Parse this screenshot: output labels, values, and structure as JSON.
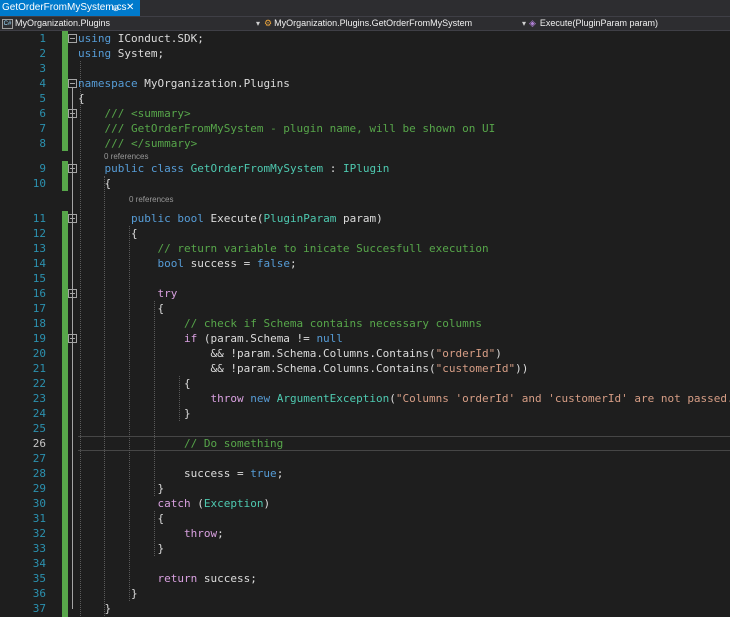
{
  "tab": {
    "filename": "GetOrderFromMySystem.cs",
    "pin": "⊕",
    "close": "✕"
  },
  "navbar": {
    "project": "MyOrganization.Plugins",
    "type_path": "MyOrganization.Plugins.GetOrderFromMySystem",
    "member": "Execute(PluginParam param)"
  },
  "colors": {
    "accent": "#007acc",
    "keyword": "#569cd6",
    "comment": "#57a64a",
    "type": "#4ec9b0",
    "string": "#d69d85",
    "control": "#d8a0df",
    "line_number": "#2b91af"
  },
  "current_line": 26,
  "codelens": {
    "class_refs": "0 references",
    "method_refs": "0 references"
  },
  "lines": [
    [
      [
        "kw",
        "using"
      ],
      [
        "p",
        " IConduct.SDK;"
      ]
    ],
    [
      [
        "kw",
        "using"
      ],
      [
        "p",
        " System;"
      ]
    ],
    [],
    [
      [
        "kw",
        "namespace"
      ],
      [
        "p",
        " MyOrganization.Plugins"
      ]
    ],
    [
      [
        "p",
        "{"
      ]
    ],
    [
      [
        "p",
        "    "
      ],
      [
        "cm",
        "/// <summary>"
      ]
    ],
    [
      [
        "p",
        "    "
      ],
      [
        "cm",
        "/// GetOrderFromMySystem - plugin name, will be shown on UI"
      ]
    ],
    [
      [
        "p",
        "    "
      ],
      [
        "cm",
        "/// </summary>"
      ]
    ],
    [
      [
        "p",
        "    "
      ],
      [
        "kw",
        "public"
      ],
      [
        "p",
        " "
      ],
      [
        "kw",
        "class"
      ],
      [
        "p",
        " "
      ],
      [
        "cl",
        "GetOrderFromMySystem"
      ],
      [
        "p",
        " : "
      ],
      [
        "cl",
        "IPlugin"
      ]
    ],
    [
      [
        "p",
        "    {"
      ]
    ],
    [
      [
        "p",
        "        "
      ],
      [
        "kw",
        "public"
      ],
      [
        "p",
        " "
      ],
      [
        "kw",
        "bool"
      ],
      [
        "p",
        " Execute("
      ],
      [
        "cl",
        "PluginParam"
      ],
      [
        "p",
        " param)"
      ]
    ],
    [
      [
        "p",
        "        {"
      ]
    ],
    [
      [
        "p",
        "            "
      ],
      [
        "cm",
        "// return variable to inicate Succesfull execution"
      ]
    ],
    [
      [
        "p",
        "            "
      ],
      [
        "kw",
        "bool"
      ],
      [
        "p",
        " success = "
      ],
      [
        "kw",
        "false"
      ],
      [
        "p",
        ";"
      ]
    ],
    [],
    [
      [
        "p",
        "            "
      ],
      [
        "if",
        "try"
      ]
    ],
    [
      [
        "p",
        "            {"
      ]
    ],
    [
      [
        "p",
        "                "
      ],
      [
        "cm",
        "// check if Schema contains necessary columns"
      ]
    ],
    [
      [
        "p",
        "                "
      ],
      [
        "if",
        "if"
      ],
      [
        "p",
        " (param.Schema != "
      ],
      [
        "kw",
        "null"
      ]
    ],
    [
      [
        "p",
        "                    && !param.Schema.Columns.Contains("
      ],
      [
        "st",
        "\"orderId\""
      ],
      [
        "p",
        ")"
      ]
    ],
    [
      [
        "p",
        "                    && !param.Schema.Columns.Contains("
      ],
      [
        "st",
        "\"customerId\""
      ],
      [
        "p",
        "))"
      ]
    ],
    [
      [
        "p",
        "                {"
      ]
    ],
    [
      [
        "p",
        "                    "
      ],
      [
        "if",
        "throw"
      ],
      [
        "p",
        " "
      ],
      [
        "kw",
        "new"
      ],
      [
        "p",
        " "
      ],
      [
        "cl",
        "ArgumentException"
      ],
      [
        "p",
        "("
      ],
      [
        "st",
        "\"Columns 'orderId' and 'customerId' are not passed.\""
      ],
      [
        "p",
        ");"
      ]
    ],
    [
      [
        "p",
        "                }"
      ]
    ],
    [],
    [
      [
        "p",
        "                "
      ],
      [
        "cm",
        "// Do something"
      ]
    ],
    [],
    [
      [
        "p",
        "                success = "
      ],
      [
        "kw",
        "true"
      ],
      [
        "p",
        ";"
      ]
    ],
    [
      [
        "p",
        "            }"
      ]
    ],
    [
      [
        "p",
        "            "
      ],
      [
        "if",
        "catch"
      ],
      [
        "p",
        " ("
      ],
      [
        "cl",
        "Exception"
      ],
      [
        "p",
        ")"
      ]
    ],
    [
      [
        "p",
        "            {"
      ]
    ],
    [
      [
        "p",
        "                "
      ],
      [
        "if",
        "throw"
      ],
      [
        "p",
        ";"
      ]
    ],
    [
      [
        "p",
        "            }"
      ]
    ],
    [],
    [
      [
        "p",
        "            "
      ],
      [
        "if",
        "return"
      ],
      [
        "p",
        " success;"
      ]
    ],
    [
      [
        "p",
        "        }"
      ]
    ],
    [
      [
        "p",
        "    }"
      ]
    ],
    [
      [
        "p",
        "}"
      ]
    ]
  ]
}
